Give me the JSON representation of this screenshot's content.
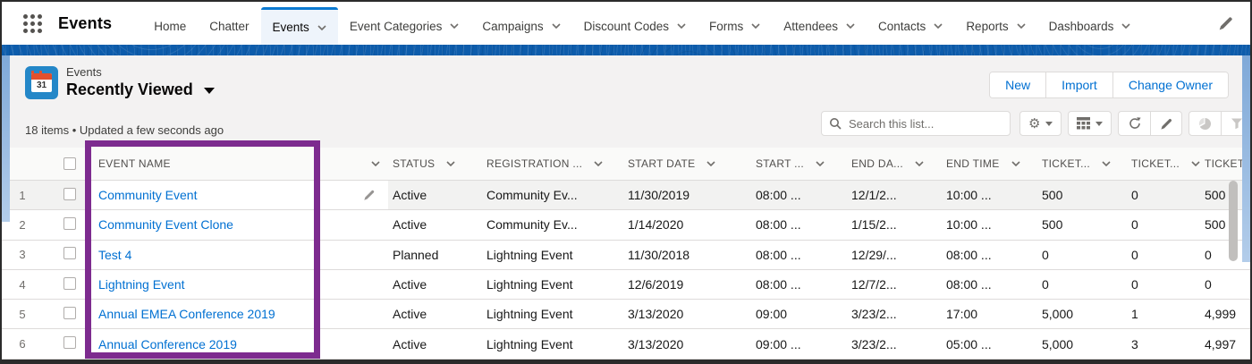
{
  "colors": {
    "brand_band": "#0d5cab",
    "accent_blue": "#0070d2",
    "selected_tab_bar": "#0b7ad1",
    "header_panel_bg": "#f3f2f2",
    "highlight_purple": "#7d2b8f",
    "row_hover": "#f2f2f1",
    "calendar_icon_bg": "#2487c8",
    "calendar_icon_top": "#e1502d"
  },
  "app": {
    "name": "Events",
    "nav_items": [
      {
        "label": "Home",
        "has_menu": false,
        "selected": false
      },
      {
        "label": "Chatter",
        "has_menu": false,
        "selected": false
      },
      {
        "label": "Events",
        "has_menu": true,
        "selected": true
      },
      {
        "label": "Event Categories",
        "has_menu": true,
        "selected": false
      },
      {
        "label": "Campaigns",
        "has_menu": true,
        "selected": false
      },
      {
        "label": "Discount Codes",
        "has_menu": true,
        "selected": false
      },
      {
        "label": "Forms",
        "has_menu": true,
        "selected": false
      },
      {
        "label": "Attendees",
        "has_menu": true,
        "selected": false
      },
      {
        "label": "Contacts",
        "has_menu": true,
        "selected": false
      },
      {
        "label": "Reports",
        "has_menu": true,
        "selected": false
      },
      {
        "label": "Dashboards",
        "has_menu": true,
        "selected": false
      }
    ]
  },
  "header": {
    "object_label": "Events",
    "list_view_title": "Recently Viewed",
    "calendar_day": "31",
    "items_info": "18 items • Updated a few seconds ago",
    "buttons": {
      "new": "New",
      "import": "Import",
      "change_owner": "Change Owner"
    },
    "search_placeholder": "Search this list..."
  },
  "toolbar": {
    "icons": [
      "settings-gear",
      "display-as-table",
      "refresh",
      "edit-pencil",
      "charts-pie",
      "filter-funnel"
    ]
  },
  "table": {
    "columns": [
      "EVENT NAME",
      "STATUS",
      "REGISTRATION ...",
      "START DATE",
      "START ...",
      "END DA...",
      "END TIME",
      "TICKET...",
      "TICKET...",
      "TICKET"
    ],
    "rows": [
      {
        "num": "1",
        "name": "Community Event",
        "status": "Active",
        "registration": "Community Ev...",
        "start_date": "11/30/2019",
        "start_time": "08:00 ...",
        "end_date": "12/1/2...",
        "end_time": "10:00 ...",
        "tickets_a": "500",
        "tickets_b": "0",
        "tickets_c": "500"
      },
      {
        "num": "2",
        "name": "Community Event Clone",
        "status": "Active",
        "registration": "Community Ev...",
        "start_date": "1/14/2020",
        "start_time": "08:00 ...",
        "end_date": "1/15/2...",
        "end_time": "10:00 ...",
        "tickets_a": "500",
        "tickets_b": "0",
        "tickets_c": "500"
      },
      {
        "num": "3",
        "name": "Test 4",
        "status": "Planned",
        "registration": "Lightning Event",
        "start_date": "11/30/2018",
        "start_time": "08:00 ...",
        "end_date": "12/29/...",
        "end_time": "08:00 ...",
        "tickets_a": "0",
        "tickets_b": "0",
        "tickets_c": "0"
      },
      {
        "num": "4",
        "name": "Lightning Event",
        "status": "Active",
        "registration": "Lightning Event",
        "start_date": "12/6/2019",
        "start_time": "08:00 ...",
        "end_date": "12/7/2...",
        "end_time": "08:00 ...",
        "tickets_a": "0",
        "tickets_b": "0",
        "tickets_c": "0"
      },
      {
        "num": "5",
        "name": "Annual EMEA Conference 2019",
        "status": "Active",
        "registration": "Lightning Event",
        "start_date": "3/13/2020",
        "start_time": "09:00",
        "end_date": "3/23/2...",
        "end_time": "17:00",
        "tickets_a": "5,000",
        "tickets_b": "1",
        "tickets_c": "4,999"
      },
      {
        "num": "6",
        "name": "Annual Conference 2019",
        "status": "Active",
        "registration": "Lightning Event",
        "start_date": "3/13/2020",
        "start_time": "09:00 ...",
        "end_date": "3/23/2...",
        "end_time": "05:00 ...",
        "tickets_a": "5,000",
        "tickets_b": "3",
        "tickets_c": "4,997"
      }
    ]
  }
}
